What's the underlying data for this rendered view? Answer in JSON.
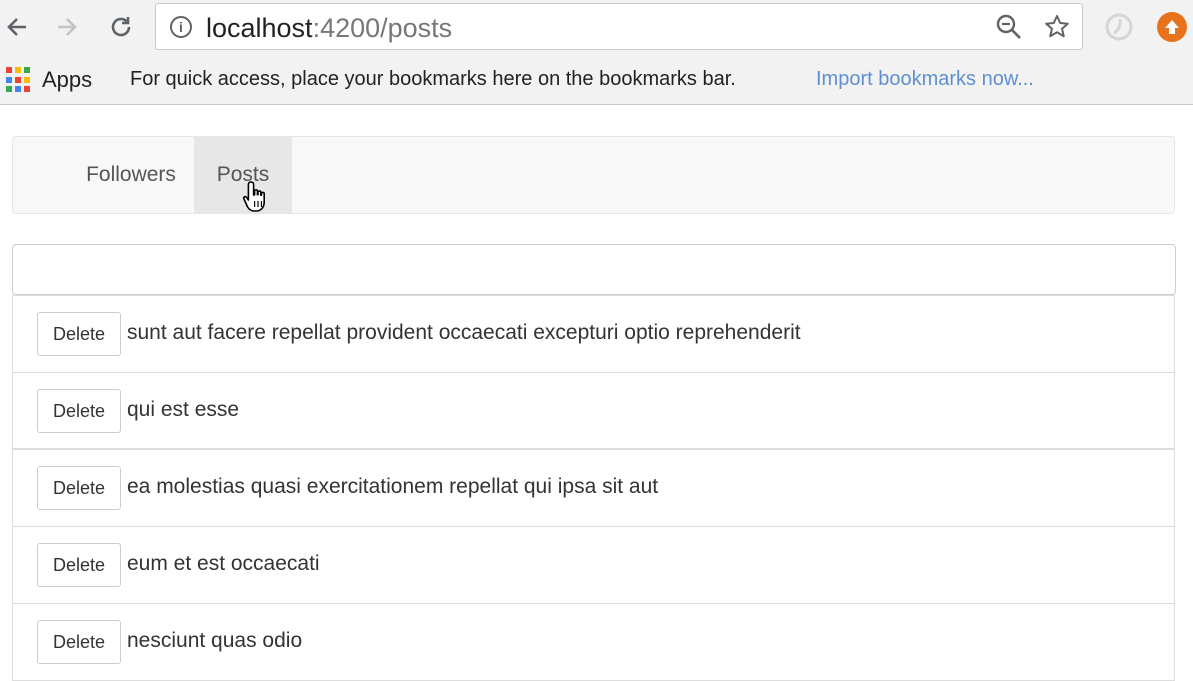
{
  "browser": {
    "url_host": "localhost",
    "url_path": ":4200/posts",
    "back_icon": "back-arrow-icon",
    "forward_icon": "forward-arrow-icon",
    "reload_icon": "reload-icon"
  },
  "bookmarks_bar": {
    "apps_label": "Apps",
    "hint": "For quick access, place your bookmarks here on the bookmarks bar.",
    "import_link": "Import bookmarks now..."
  },
  "navbar": {
    "links": [
      {
        "label": "Followers",
        "active": false
      },
      {
        "label": "Posts",
        "active": true
      }
    ]
  },
  "new_post": {
    "value": "",
    "placeholder": ""
  },
  "posts": [
    {
      "title": "sunt aut facere repellat provident occaecati excepturi optio reprehenderit",
      "delete_label": "Delete"
    },
    {
      "title": "qui est esse",
      "delete_label": "Delete"
    },
    {
      "title": "ea molestias quasi exercitationem repellat qui ipsa sit aut",
      "delete_label": "Delete"
    },
    {
      "title": "eum et est occaecati",
      "delete_label": "Delete"
    },
    {
      "title": "nesciunt quas odio",
      "delete_label": "Delete"
    }
  ],
  "colors": {
    "link": "#5f8fd0",
    "navbar_bg": "#f8f8f8",
    "active_tab_bg": "#e7e7e7",
    "extension_orange": "#e8711c"
  }
}
